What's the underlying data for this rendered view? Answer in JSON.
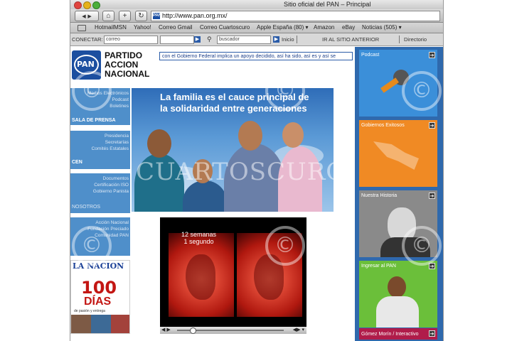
{
  "window": {
    "title": "Sitio oficial del PAN – Principal"
  },
  "toolbar": {
    "back": "◀",
    "forward": "▶",
    "home": "⌂",
    "add": "+",
    "reload": "↻",
    "favicon": "PAN",
    "url": "http://www.pan.org.mx/"
  },
  "bookmarks": [
    "HotmailMSN",
    "Yahoo!",
    "Correo Gmail",
    "Correo Cuartoscuro",
    "Apple España (80) ▾",
    "Amazon",
    "eBay",
    "Noticias (505) ▾"
  ],
  "site_toolbar": {
    "conectar_label": "CONECTAR:",
    "correo_value": "correo",
    "buscador_value": "buscador",
    "inicio_label": "Inicio",
    "ir_label": "IR AL SITIO ANTERIOR",
    "directorio_label": "Directorio"
  },
  "logo": {
    "mark": "PAN",
    "name_line1": "PARTIDO",
    "name_line2": "ACCION",
    "name_line3": "NACIONAL"
  },
  "ticker": "con el Gobierno Federal implica un apoyo decidido, así ha sido, así es y así se",
  "left_nav": {
    "group1_links": [
      "Medios Electrónicos",
      "Podcast",
      "Boletines"
    ],
    "group1_title": "SALA DE PRENSA",
    "group2_links": [
      "Presidencia",
      "Secretarías",
      "Comités Estatales"
    ],
    "group2_title": "CEN",
    "group3_links": [
      "Documentos",
      "Certificación ISO",
      "Gobierno Panista"
    ],
    "group3_title": "NOSOTROS",
    "group4_links": [
      "Acción Nacional",
      "Fundación Preciado",
      "Comunidad PAN"
    ]
  },
  "banner": {
    "line1": "La familia es el cauce principal de",
    "line2": "la solidaridad entre generaciones"
  },
  "video": {
    "caption_line1": "12 semanas",
    "caption_line2": "1 segundo",
    "play": "◀ ▶",
    "right_controls": "◀▶ ▾"
  },
  "magazine": {
    "title": "LA NACION",
    "big_number": "100",
    "big_word": "DÍAS",
    "subtitle": "de pasión y entrega"
  },
  "right_cards": [
    {
      "title": "Podcast",
      "color": "#3b8fd9"
    },
    {
      "title": "Gobiernos Exitosos",
      "color": "#f08a24"
    },
    {
      "title": "Nuestra Historia",
      "color": "#8a8a8a"
    },
    {
      "title": "Ingresar al PAN",
      "color": "#6bbf3a"
    }
  ],
  "right_bottom": {
    "title": "Gómez Morín / Interactivo"
  },
  "watermark": {
    "text": "CUARTOSCURO",
    "symbol": "©"
  }
}
